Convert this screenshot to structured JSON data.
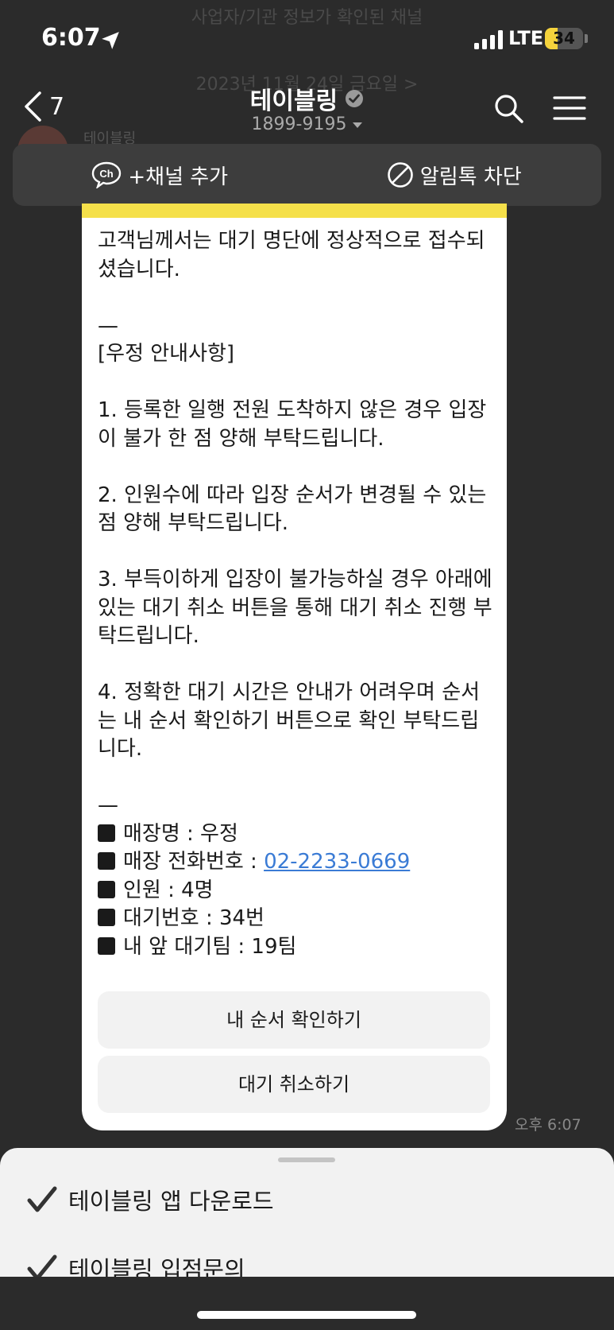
{
  "background_text": {
    "verified_notice": "사업자/기관 정보가 확인된 채널",
    "date": "2023년 11월 24일 금요일 >",
    "sender": "테이블링"
  },
  "status_bar": {
    "time": "6:07",
    "network": "LTE",
    "battery": "34",
    "battery_level": 0.34
  },
  "header": {
    "back_count": "7",
    "title": "테이블링",
    "phone": "1899-9195"
  },
  "action_bar": {
    "add_channel": "+채널 추가",
    "block_alimtalk": "알림톡 차단"
  },
  "message": {
    "intro": "고객님께서는 대기 명단에 정상적으로 접수되셨습니다.",
    "divider": "—",
    "notice_title": "[우정 안내사항]",
    "notice_1": "1. 등록한 일행 전원 도착하지 않은 경우 입장이 불가 한 점 양해 부탁드립니다.",
    "notice_2": "2. 인원수에 따라 입장 순서가 변경될 수 있는 점 양해 부탁드립니다.",
    "notice_3": "3. 부득이하게 입장이 불가능하실 경우 아래에 있는 대기 취소 버튼을 통해 대기 취소 진행 부탁드립니다.",
    "notice_4": "4. 정확한 대기 시간은 안내가 어려우며 순서는 내 순서 확인하기 버튼으로 확인 부탁드립니다.",
    "store_name": "매장명 : 우정",
    "store_phone_label": "매장 전화번호 : ",
    "store_phone": "02-2233-0669",
    "party_size": "인원 : 4명",
    "wait_number": "대기번호 : 34번",
    "teams_ahead": "내 앞 대기팀 : 19팀",
    "check_order_button": "내 순서 확인하기",
    "cancel_button": "대기 취소하기",
    "timestamp": "오후 6:07"
  },
  "bottom_sheet": {
    "items": [
      "테이블링 앱 다운로드",
      "테이블링 입점문의"
    ]
  }
}
